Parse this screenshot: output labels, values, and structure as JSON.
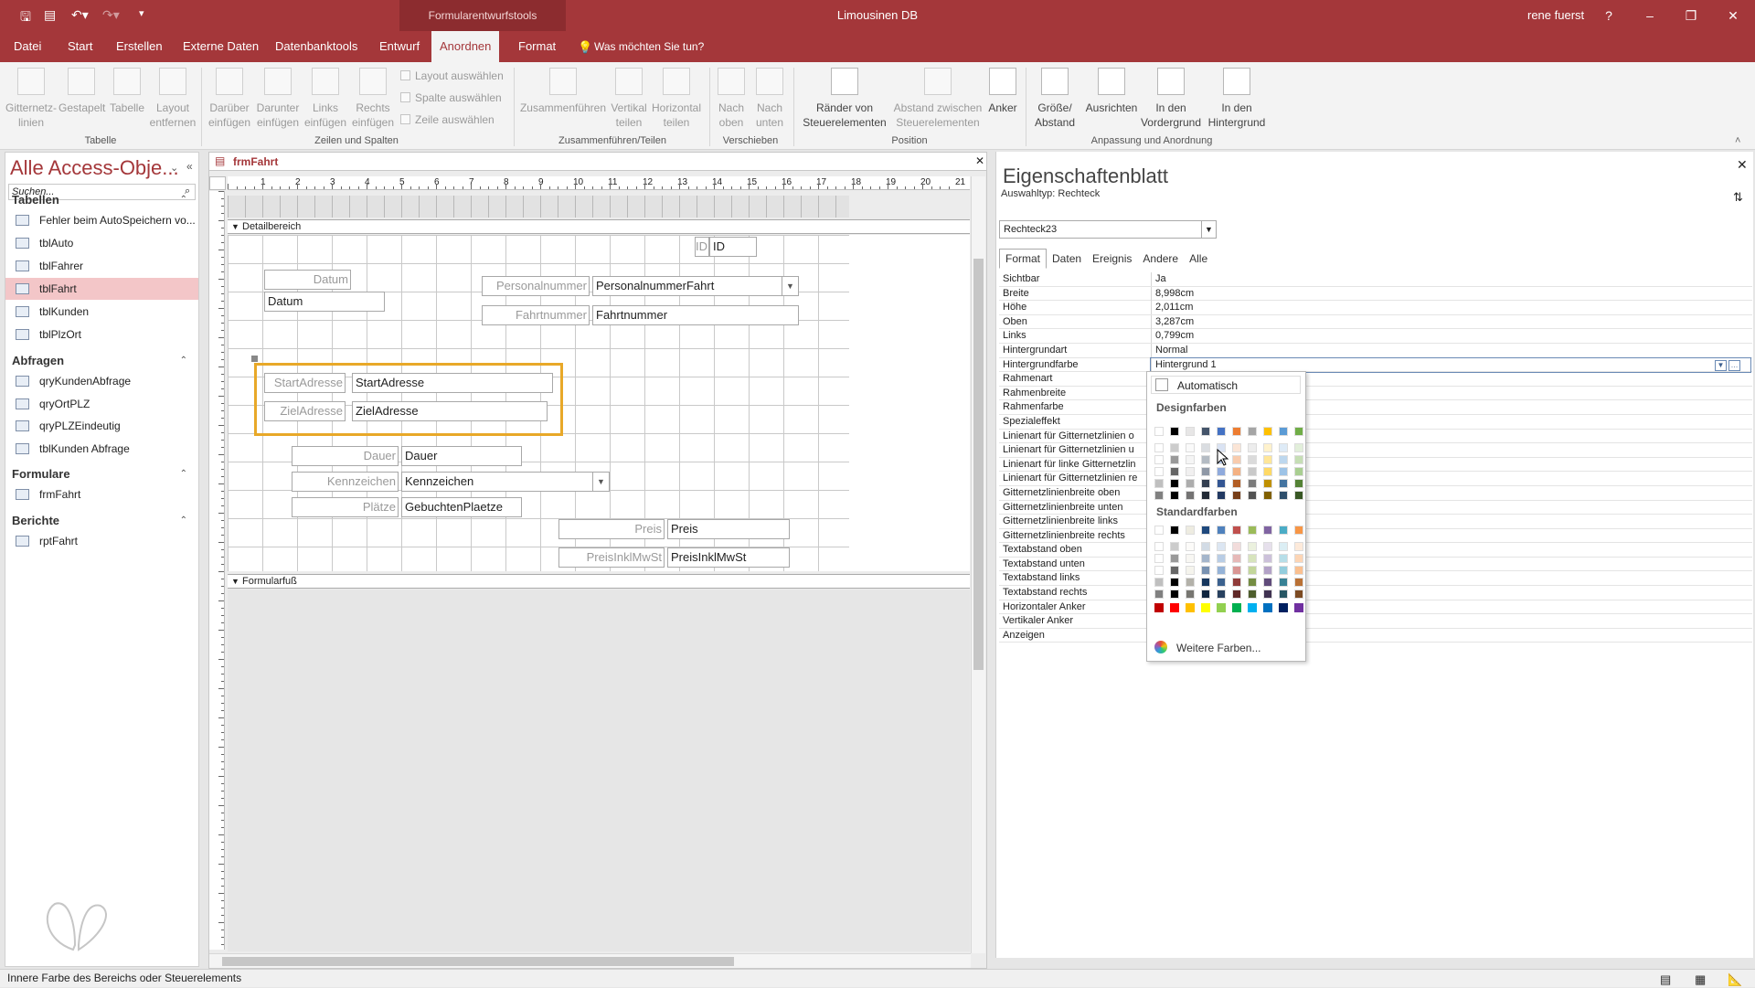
{
  "titlebar": {
    "context_tab": "Formularentwurfstools",
    "title": "Limousinen DB",
    "user": "rene fuerst",
    "help": "?",
    "minimize": "–",
    "restore": "❐",
    "close": "✕"
  },
  "menu": {
    "items": [
      "Datei",
      "Start",
      "Erstellen",
      "Externe Daten",
      "Datenbanktools",
      "Entwurf",
      "Anordnen",
      "Format"
    ],
    "tell_me": "Was möchten Sie tun?"
  },
  "ribbon": {
    "tabelle": {
      "gitternetz": "Gitternetz-\nlinien",
      "gestapelt": "Gestapelt",
      "tabelle": "Tabelle",
      "layout": "Layout\nentfernen",
      "label": "Tabelle"
    },
    "zeilen": {
      "darueber": "Darüber\neinfügen",
      "darunter": "Darunter\neinfügen",
      "links": "Links\neinfügen",
      "rechts": "Rechts\neinfügen",
      "layout_ausw": "Layout auswählen",
      "spalte_ausw": "Spalte auswählen",
      "zeile_ausw": "Zeile auswählen",
      "label": "Zeilen und Spalten"
    },
    "zusammen": {
      "zusammenfuehren": "Zusammenführen",
      "vertikal": "Vertikal\nteilen",
      "horizontal": "Horizontal\nteilen",
      "label": "Zusammenführen/Teilen"
    },
    "verschieben": {
      "oben": "Nach\noben",
      "unten": "Nach\nunten",
      "label": "Verschieben"
    },
    "position": {
      "raender": "Ränder von\nSteuerelementen",
      "abstand": "Abstand zwischen\nSteuerelementen",
      "anker": "Anker",
      "label": "Position"
    },
    "anpassung": {
      "groesse": "Größe/\nAbstand",
      "ausrichten": "Ausrichten",
      "vordergrund": "In den\nVordergrund",
      "hintergrund": "In den\nHintergrund",
      "label": "Anpassung und Anordnung"
    }
  },
  "nav": {
    "title": "Alle Access-Obje...",
    "search_placeholder": "Suchen...",
    "groups": [
      {
        "name": "Tabellen",
        "items": [
          "Fehler beim AutoSpeichern vo...",
          "tblAuto",
          "tblFahrer",
          "tblFahrt",
          "tblKunden",
          "tblPlzOrt"
        ]
      },
      {
        "name": "Abfragen",
        "items": [
          "qryKundenAbfrage",
          "qryOrtPLZ",
          "qryPLZEindeutig",
          "tblKunden Abfrage"
        ]
      },
      {
        "name": "Formulare",
        "items": [
          "frmFahrt"
        ]
      },
      {
        "name": "Berichte",
        "items": [
          "rptFahrt"
        ]
      }
    ],
    "selected": "tblFahrt"
  },
  "document": {
    "tab": "frmFahrt",
    "detail_section": "Detailbereich",
    "footer_section": "Formularfuß",
    "ruler_numbers": [
      "1",
      "2",
      "3",
      "4",
      "5",
      "6",
      "7",
      "8",
      "9",
      "10",
      "11",
      "12",
      "13",
      "14",
      "15",
      "16",
      "17",
      "18",
      "19",
      "20",
      "21"
    ],
    "controls": {
      "id_label": "ID",
      "id_field": "ID",
      "datum_label": "Datum",
      "datum_field": "Datum",
      "pnr_label": "Personalnummer",
      "pnr_field": "PersonalnummerFahrt",
      "fnr_label": "Fahrtnummer",
      "fnr_field": "Fahrtnummer",
      "start_label": "StartAdresse",
      "start_field": "StartAdresse",
      "ziel_label": "ZielAdresse",
      "ziel_field": "ZielAdresse",
      "dauer_label": "Dauer",
      "dauer_field": "Dauer",
      "kenn_label": "Kennzeichen",
      "kenn_field": "Kennzeichen",
      "plaetze_label": "Plätze",
      "plaetze_field": "GebuchtenPlaetze",
      "preis_label": "Preis",
      "preis_field": "Preis",
      "preisinkl_label": "PreisInklMwSt",
      "preisinkl_field": "PreisInklMwSt"
    }
  },
  "props": {
    "title": "Eigenschaftenblatt",
    "auswahltyp_label": "Auswahltyp:",
    "auswahltyp": "Rechteck",
    "selected_object": "Rechteck23",
    "tabs": [
      "Format",
      "Daten",
      "Ereignis",
      "Andere",
      "Alle"
    ],
    "rows": [
      {
        "k": "Sichtbar",
        "v": "Ja"
      },
      {
        "k": "Breite",
        "v": "8,998cm"
      },
      {
        "k": "Höhe",
        "v": "2,011cm"
      },
      {
        "k": "Oben",
        "v": "3,287cm"
      },
      {
        "k": "Links",
        "v": "0,799cm"
      },
      {
        "k": "Hintergrundart",
        "v": "Normal"
      },
      {
        "k": "Hintergrundfarbe",
        "v": "Hintergrund 1"
      },
      {
        "k": "Rahmenart",
        "v": ""
      },
      {
        "k": "Rahmenbreite",
        "v": ""
      },
      {
        "k": "Rahmenfarbe",
        "v": ""
      },
      {
        "k": "Spezialeffekt",
        "v": ""
      },
      {
        "k": "Linienart für Gitternetzlinien o",
        "v": ""
      },
      {
        "k": "Linienart für Gitternetzlinien u",
        "v": ""
      },
      {
        "k": "Linienart für linke Gitternetzlin",
        "v": ""
      },
      {
        "k": "Linienart für Gitternetzlinien re",
        "v": ""
      },
      {
        "k": "Gitternetzlinienbreite oben",
        "v": ""
      },
      {
        "k": "Gitternetzlinienbreite unten",
        "v": ""
      },
      {
        "k": "Gitternetzlinienbreite links",
        "v": ""
      },
      {
        "k": "Gitternetzlinienbreite rechts",
        "v": ""
      },
      {
        "k": "Textabstand oben",
        "v": ""
      },
      {
        "k": "Textabstand unten",
        "v": ""
      },
      {
        "k": "Textabstand links",
        "v": ""
      },
      {
        "k": "Textabstand rechts",
        "v": ""
      },
      {
        "k": "Horizontaler Anker",
        "v": ""
      },
      {
        "k": "Vertikaler Anker",
        "v": ""
      },
      {
        "k": "Anzeigen",
        "v": ""
      }
    ]
  },
  "picker": {
    "automatic": "Automatisch",
    "design_colors": "Designfarben",
    "standard_colors": "Standardfarben",
    "more_colors": "Weitere Farben...",
    "design_top": [
      "#ffffff",
      "#000000",
      "#e7e6e6",
      "#44546a",
      "#4472c4",
      "#ed7d31",
      "#a5a5a5",
      "#ffc000",
      "#5b9bd5",
      "#70ad47"
    ],
    "standard_top": [
      "#ffffff",
      "#000000",
      "#eeece1",
      "#1f497d",
      "#4f81bd",
      "#c0504d",
      "#9bbb59",
      "#8064a2",
      "#4bacc6",
      "#f79646"
    ],
    "standard_bottom": [
      "#c00000",
      "#ff0000",
      "#ffc000",
      "#ffff00",
      "#92d050",
      "#00b050",
      "#00b0f0",
      "#0070c0",
      "#002060",
      "#7030a0"
    ]
  },
  "status": {
    "text": "Innere Farbe des Bereichs oder Steuerelements"
  }
}
